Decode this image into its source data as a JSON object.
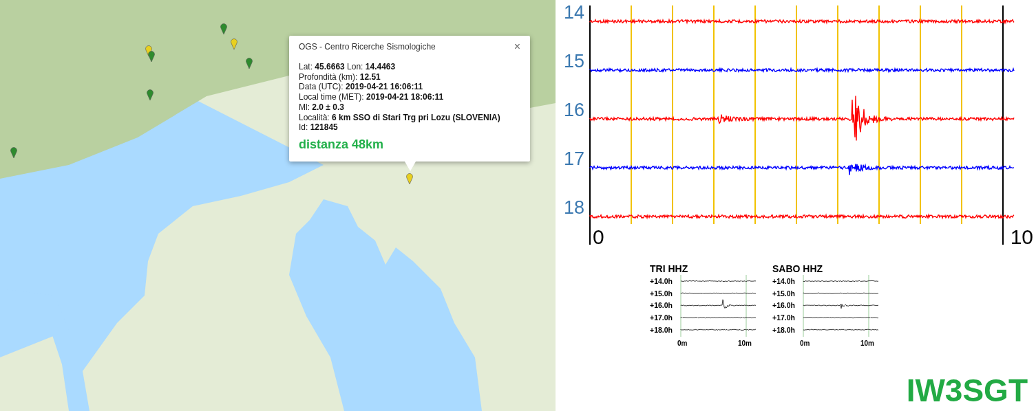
{
  "popup": {
    "title": "OGS - Centro Ricerche Sismologiche",
    "close": "×",
    "lines": [
      "Lat: **45.6663** Lon: **14.4463**",
      "Profondità (km): **12.51**",
      "Data (UTC): **2019-04-21 16:06:11**",
      "Local time (MET): **2019-04-21 18:06:11**",
      "Ml: **2.0 ± 0.3**",
      "Località: **6 km SSO di Stari Trg pri Lozu (SLOVENIA)**",
      "Id: **121845**"
    ],
    "distance": "distanza 48km"
  },
  "seismogram": {
    "rows": [
      {
        "label": "14",
        "color": "#ff0000"
      },
      {
        "label": "15",
        "color": "#0000ff"
      },
      {
        "label": "16",
        "color": "#ff0000"
      },
      {
        "label": "17",
        "color": "#0000ff"
      },
      {
        "label": "18",
        "color": "#ff0000"
      }
    ],
    "axis": [
      "0",
      "10"
    ]
  },
  "helicorders": [
    {
      "title": "TRI HHZ",
      "rows": [
        "+14.0h",
        "+15.0h",
        "+16.0h",
        "+17.0h",
        "+18.0h"
      ],
      "axis": [
        "0m",
        "10m"
      ]
    },
    {
      "title": "SABO HHZ",
      "rows": [
        "+14.0h",
        "+15.0h",
        "+16.0h",
        "+17.0h",
        "+18.0h"
      ],
      "axis": [
        "0m",
        "10m"
      ]
    }
  ],
  "logo": "IW3SGT"
}
